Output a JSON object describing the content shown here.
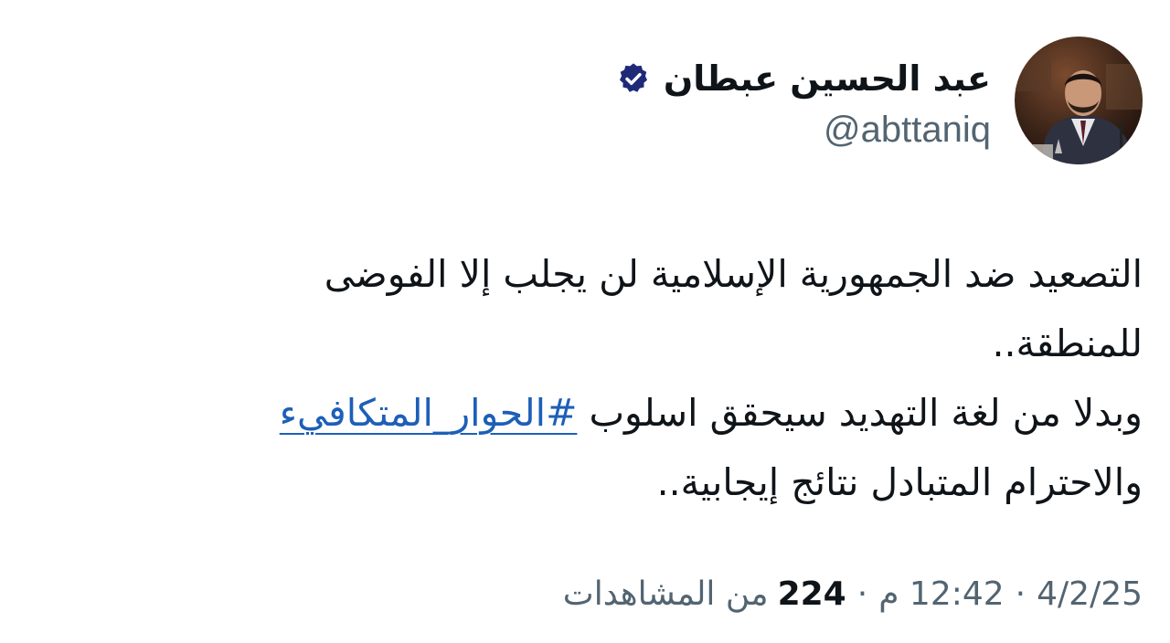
{
  "author": {
    "display_name": "عبد الحسين عبطان",
    "handle": "@abttaniq",
    "verified": true,
    "avatar_icon": "profile-photo",
    "verified_icon": "verified-badge-icon"
  },
  "tweet": {
    "line1": "التصعيد ضد الجمهورية الإسلامية لن يجلب إلا الفوضى",
    "line2": "للمنطقة..",
    "line3_before": "وبدلا من لغة التهديد سيحقق اسلوب ",
    "hashtag": "#الحوار_المتكافيء",
    "line4": "والاحترام المتبادل نتائج إيجابية.."
  },
  "meta": {
    "date": "4/2/25",
    "time": "12:42 م",
    "views_count": "224",
    "views_label": "من المشاهدات",
    "separator": "·"
  },
  "colors": {
    "text": "#0f1419",
    "secondary": "#536471",
    "link": "#1d5fb8",
    "verified_badge": "#1e2a78"
  }
}
